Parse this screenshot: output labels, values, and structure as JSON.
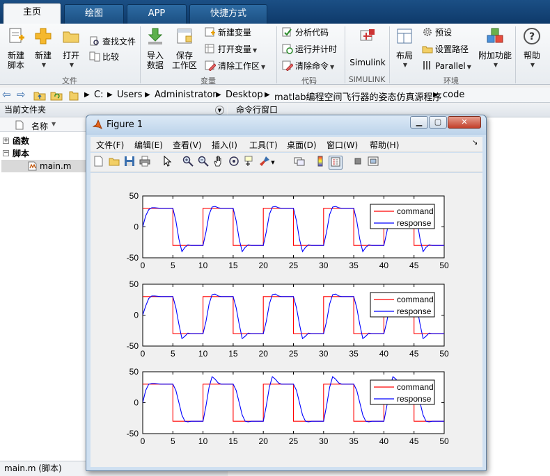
{
  "tabs": [
    "主页",
    "绘图",
    "APP",
    "快捷方式"
  ],
  "ribbon": {
    "new_script": "新建\n脚本",
    "new": "新建",
    "open": "打开",
    "find_files": "查找文件",
    "compare": "比较",
    "import_data": "导入\n数据",
    "save_workspace": "保存\n工作区",
    "new_variable": "新建变量",
    "open_variable": "打开变量",
    "clear_workspace": "清除工作区",
    "analyze_code": "分析代码",
    "run_and_time": "运行并计时",
    "clear_commands": "清除命令",
    "simulink": "Simulink",
    "layout": "布局",
    "preferences": "预设",
    "set_path": "设置路径",
    "parallel": "Parallel",
    "addons": "附加功能",
    "help": "帮助",
    "groups": {
      "file": "文件",
      "variable": "变量",
      "code": "代码",
      "simulink": "SIMULINK",
      "environment": "环境"
    }
  },
  "address": {
    "parts": [
      "C:",
      "Users",
      "Administrator",
      "Desktop",
      "matlab编程空间飞行器的姿态仿真源程序",
      "code"
    ]
  },
  "left_panel": {
    "title": "当前文件夹",
    "column_name": "名称",
    "items": [
      "函数",
      "脚本",
      "main.m"
    ],
    "status": "main.m  (脚本)"
  },
  "right_panel": {
    "title": "命令行窗口"
  },
  "figure": {
    "title": "Figure 1",
    "menus": [
      "文件(F)",
      "编辑(E)",
      "查看(V)",
      "插入(I)",
      "工具(T)",
      "桌面(D)",
      "窗口(W)",
      "帮助(H)"
    ]
  },
  "chart_data": [
    {
      "type": "line",
      "xlim": [
        0,
        50
      ],
      "ylim": [
        -50,
        50
      ],
      "xticks": [
        0,
        5,
        10,
        15,
        20,
        25,
        30,
        35,
        40,
        45,
        50
      ],
      "yticks": [
        -50,
        0,
        50
      ],
      "legend_position": "top-right",
      "series": [
        {
          "name": "command",
          "color": "#ff0000",
          "x": [
            0,
            5,
            5,
            10,
            10,
            15,
            15,
            20,
            20,
            25,
            25,
            30,
            30,
            35,
            35,
            40,
            40,
            45,
            45,
            50
          ],
          "y": [
            30,
            30,
            -30,
            -30,
            30,
            30,
            -30,
            -30,
            30,
            30,
            -30,
            -30,
            30,
            30,
            -30,
            -30,
            30,
            30,
            -30,
            -30
          ]
        },
        {
          "name": "response",
          "color": "#0000ff",
          "x": [
            0,
            0.5,
            1,
            1.5,
            2,
            3,
            5,
            5.5,
            6,
            6.5,
            7,
            7.5,
            8,
            10,
            10.5,
            11,
            11.5,
            12,
            12.5,
            13,
            15,
            15.5,
            16,
            16.5,
            17,
            17.5,
            18,
            20,
            20.5,
            21,
            21.5,
            22,
            22.5,
            23,
            25,
            25.5,
            26,
            26.5,
            27,
            27.5,
            28,
            30,
            30.5,
            31,
            31.5,
            32,
            32.5,
            33,
            35,
            35.5,
            36,
            36.5,
            37,
            37.5,
            38,
            40,
            40.5,
            41,
            41.5,
            42,
            42.5,
            43,
            45,
            45.5,
            46,
            46.5,
            47,
            47.5,
            48,
            50
          ],
          "y": [
            0,
            18,
            28,
            31,
            31,
            30,
            30,
            10,
            -20,
            -40,
            -33,
            -29,
            -30,
            -30,
            -8,
            20,
            32,
            33,
            31,
            30,
            30,
            10,
            -20,
            -40,
            -33,
            -29,
            -30,
            -30,
            -8,
            20,
            32,
            33,
            31,
            30,
            30,
            10,
            -20,
            -40,
            -33,
            -29,
            -30,
            -30,
            -8,
            20,
            32,
            33,
            31,
            30,
            30,
            10,
            -20,
            -40,
            -33,
            -29,
            -30,
            -30,
            -8,
            20,
            32,
            33,
            31,
            30,
            30,
            10,
            -20,
            -40,
            -33,
            -29,
            -30,
            -30
          ]
        }
      ]
    },
    {
      "type": "line",
      "xlim": [
        0,
        50
      ],
      "ylim": [
        -50,
        50
      ],
      "xticks": [
        0,
        5,
        10,
        15,
        20,
        25,
        30,
        35,
        40,
        45,
        50
      ],
      "yticks": [
        -50,
        0,
        50
      ],
      "legend_position": "top-right",
      "series": [
        {
          "name": "command",
          "color": "#ff0000",
          "x": [
            0,
            5,
            5,
            10,
            10,
            15,
            15,
            20,
            20,
            25,
            25,
            30,
            30,
            35,
            35,
            40,
            40,
            45,
            45,
            50
          ],
          "y": [
            30,
            30,
            -30,
            -30,
            30,
            30,
            -30,
            -30,
            30,
            30,
            -30,
            -30,
            30,
            30,
            -30,
            -30,
            30,
            30,
            -30,
            -30
          ]
        },
        {
          "name": "response",
          "color": "#0000ff",
          "x": [
            0,
            0.5,
            1,
            1.5,
            2,
            3,
            5,
            5.5,
            6,
            6.5,
            7,
            7.5,
            8,
            10,
            10.5,
            11,
            11.5,
            12,
            12.5,
            13,
            15,
            15.5,
            16,
            16.5,
            17,
            17.5,
            18,
            20,
            20.5,
            21,
            21.5,
            22,
            22.5,
            23,
            25,
            25.5,
            26,
            26.5,
            27,
            27.5,
            28,
            30,
            30.5,
            31,
            31.5,
            32,
            32.5,
            33,
            35,
            35.5,
            36,
            36.5,
            37,
            37.5,
            38,
            40,
            40.5,
            41,
            41.5,
            42,
            42.5,
            43,
            45,
            45.5,
            46,
            46.5,
            47,
            47.5,
            48,
            50
          ],
          "y": [
            0,
            15,
            27,
            31,
            31,
            30,
            30,
            12,
            -15,
            -38,
            -34,
            -29,
            -30,
            -30,
            -10,
            18,
            33,
            34,
            31,
            30,
            30,
            12,
            -15,
            -38,
            -34,
            -29,
            -30,
            -30,
            -10,
            18,
            33,
            34,
            31,
            30,
            30,
            12,
            -15,
            -38,
            -34,
            -29,
            -30,
            -30,
            -10,
            18,
            33,
            34,
            31,
            30,
            30,
            12,
            -15,
            -38,
            -34,
            -29,
            -30,
            -30,
            -10,
            18,
            33,
            34,
            31,
            30,
            30,
            12,
            -15,
            -38,
            -34,
            -29,
            -30,
            -30
          ]
        }
      ]
    },
    {
      "type": "line",
      "xlim": [
        0,
        50
      ],
      "ylim": [
        -50,
        50
      ],
      "xticks": [
        0,
        5,
        10,
        15,
        20,
        25,
        30,
        35,
        40,
        45,
        50
      ],
      "yticks": [
        -50,
        0,
        50
      ],
      "legend_position": "top-right",
      "series": [
        {
          "name": "command",
          "color": "#ff0000",
          "x": [
            0,
            5,
            5,
            10,
            10,
            15,
            15,
            20,
            20,
            25,
            25,
            30,
            30,
            35,
            35,
            40,
            40,
            45,
            45,
            50
          ],
          "y": [
            30,
            30,
            -30,
            -30,
            30,
            30,
            -30,
            -30,
            30,
            30,
            -30,
            -30,
            30,
            30,
            -30,
            -30,
            30,
            30,
            -30,
            -30
          ]
        },
        {
          "name": "response",
          "color": "#0000ff",
          "x": [
            0,
            0.5,
            1,
            1.5,
            2,
            3,
            5,
            5.5,
            6,
            6.5,
            7,
            7.5,
            8,
            10,
            10.5,
            11,
            11.5,
            12,
            12.5,
            13,
            15,
            15.5,
            16,
            16.5,
            17,
            17.5,
            18,
            20,
            20.5,
            21,
            21.5,
            22,
            22.5,
            23,
            25,
            25.5,
            26,
            26.5,
            27,
            27.5,
            28,
            30,
            30.5,
            31,
            31.5,
            32,
            32.5,
            33,
            35,
            35.5,
            36,
            36.5,
            37,
            37.5,
            38,
            40,
            40.5,
            41,
            41.5,
            42,
            42.5,
            43,
            45,
            45.5,
            46,
            46.5,
            47,
            47.5,
            48,
            50
          ],
          "y": [
            0,
            20,
            30,
            31,
            31,
            30,
            30,
            20,
            0,
            -20,
            -30,
            -31,
            -30,
            -30,
            -5,
            25,
            42,
            38,
            32,
            30,
            30,
            20,
            0,
            -20,
            -30,
            -31,
            -30,
            -30,
            -5,
            25,
            42,
            38,
            32,
            30,
            30,
            20,
            0,
            -20,
            -30,
            -31,
            -30,
            -30,
            -5,
            25,
            42,
            38,
            32,
            30,
            30,
            20,
            0,
            -20,
            -30,
            -31,
            -30,
            -30,
            -5,
            25,
            42,
            38,
            32,
            30,
            30,
            20,
            0,
            -20,
            -30,
            -31,
            -30,
            -30
          ]
        }
      ]
    }
  ]
}
